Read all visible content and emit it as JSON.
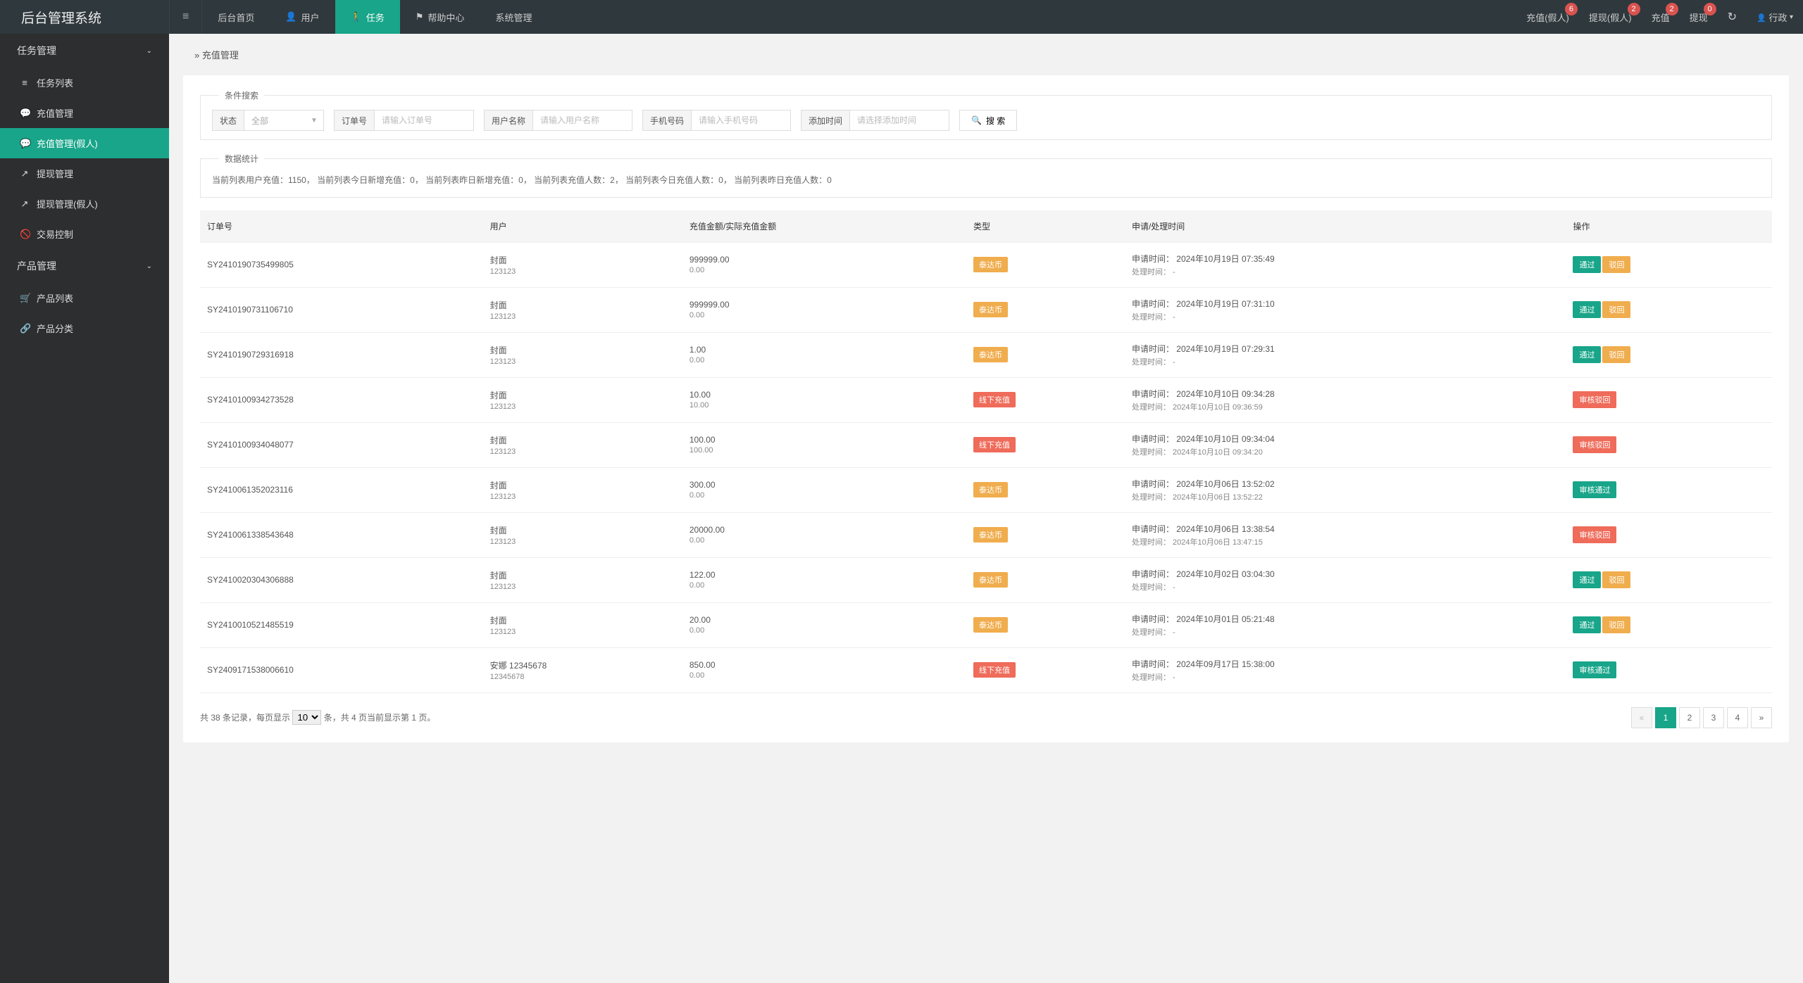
{
  "top": {
    "brand": "后台管理系统",
    "nav": [
      {
        "label": "后台首页"
      },
      {
        "label": "用户",
        "icon": "user"
      },
      {
        "label": "任务",
        "icon": "walk",
        "active": true
      },
      {
        "label": "帮助中心",
        "icon": "flag"
      },
      {
        "label": "系统管理"
      }
    ],
    "right": [
      {
        "label": "充值(假人)",
        "badge": "6"
      },
      {
        "label": "提现(假人)",
        "badge": "2"
      },
      {
        "label": "充值",
        "badge": "2"
      },
      {
        "label": "提现",
        "badge": "0"
      }
    ],
    "admin_label": "行政"
  },
  "sidebar": {
    "groups": [
      {
        "title": "任务管理",
        "items": [
          {
            "icon": "list",
            "label": "任务列表"
          },
          {
            "icon": "chat",
            "label": "充值管理"
          },
          {
            "icon": "chat",
            "label": "充值管理(假人)",
            "active": true
          },
          {
            "icon": "out",
            "label": "提现管理"
          },
          {
            "icon": "out",
            "label": "提现管理(假人)"
          },
          {
            "icon": "ban",
            "label": "交易控制"
          }
        ]
      },
      {
        "title": "产品管理",
        "items": [
          {
            "icon": "cart",
            "label": "产品列表"
          },
          {
            "icon": "link",
            "label": "产品分类"
          }
        ]
      }
    ]
  },
  "breadcrumb": "充值管理",
  "search": {
    "legend": "条件搜索",
    "status_label": "状态",
    "status_value": "全部",
    "orderno_label": "订单号",
    "orderno_ph": "请输入订单号",
    "username_label": "用户名称",
    "username_ph": "请输入用户名称",
    "phone_label": "手机号码",
    "phone_ph": "请输入手机号码",
    "time_label": "添加时间",
    "time_ph": "请选择添加时间",
    "btn": "搜 索"
  },
  "stats": {
    "legend": "数据统计",
    "text": "当前列表用户充值：1150，   当前列表今日新增充值：0，   当前列表昨日新增充值：0，   当前列表充值人数：2，   当前列表今日充值人数：0，   当前列表昨日充值人数：0"
  },
  "columns": [
    "订单号",
    "用户",
    "充值金额/实际充值金额",
    "类型",
    "申请/处理时间",
    "操作"
  ],
  "time_labels": {
    "apply": "申请时间：",
    "process": "处理时间："
  },
  "rows": [
    {
      "order": "SY2410190735499805",
      "user1": "封面",
      "user2": "123123",
      "amt1": "999999.00",
      "amt2": "0.00",
      "type": "泰达币",
      "typec": "tag-orange",
      "apply": "2024年10月19日 07:35:49",
      "process": "-",
      "ops": [
        {
          "t": "通过",
          "c": "btn-green"
        },
        {
          "t": "驳回",
          "c": "btn-yellow"
        }
      ]
    },
    {
      "order": "SY2410190731106710",
      "user1": "封面",
      "user2": "123123",
      "amt1": "999999.00",
      "amt2": "0.00",
      "type": "泰达币",
      "typec": "tag-orange",
      "apply": "2024年10月19日 07:31:10",
      "process": "-",
      "ops": [
        {
          "t": "通过",
          "c": "btn-green"
        },
        {
          "t": "驳回",
          "c": "btn-yellow"
        }
      ]
    },
    {
      "order": "SY2410190729316918",
      "user1": "封面",
      "user2": "123123",
      "amt1": "1.00",
      "amt2": "0.00",
      "type": "泰达币",
      "typec": "tag-orange",
      "apply": "2024年10月19日 07:29:31",
      "process": "-",
      "ops": [
        {
          "t": "通过",
          "c": "btn-green"
        },
        {
          "t": "驳回",
          "c": "btn-yellow"
        }
      ]
    },
    {
      "order": "SY2410100934273528",
      "user1": "封面",
      "user2": "123123",
      "amt1": "10.00",
      "amt2": "10.00",
      "type": "线下充值",
      "typec": "tag-red",
      "apply": "2024年10月10日 09:34:28",
      "process": "2024年10月10日 09:36:59",
      "ops": [
        {
          "t": "审核驳回",
          "c": "btn-danger"
        }
      ]
    },
    {
      "order": "SY2410100934048077",
      "user1": "封面",
      "user2": "123123",
      "amt1": "100.00",
      "amt2": "100.00",
      "type": "线下充值",
      "typec": "tag-red",
      "apply": "2024年10月10日 09:34:04",
      "process": "2024年10月10日 09:34:20",
      "ops": [
        {
          "t": "审核驳回",
          "c": "btn-danger"
        }
      ]
    },
    {
      "order": "SY2410061352023116",
      "user1": "封面",
      "user2": "123123",
      "amt1": "300.00",
      "amt2": "0.00",
      "type": "泰达币",
      "typec": "tag-orange",
      "apply": "2024年10月06日 13:52:02",
      "process": "2024年10月06日 13:52:22",
      "ops": [
        {
          "t": "审核通过",
          "c": "btn-green"
        }
      ]
    },
    {
      "order": "SY2410061338543648",
      "user1": "封面",
      "user2": "123123",
      "amt1": "20000.00",
      "amt2": "0.00",
      "type": "泰达币",
      "typec": "tag-orange",
      "apply": "2024年10月06日 13:38:54",
      "process": "2024年10月06日 13:47:15",
      "ops": [
        {
          "t": "审核驳回",
          "c": "btn-danger"
        }
      ]
    },
    {
      "order": "SY2410020304306888",
      "user1": "封面",
      "user2": "123123",
      "amt1": "122.00",
      "amt2": "0.00",
      "type": "泰达币",
      "typec": "tag-orange",
      "apply": "2024年10月02日 03:04:30",
      "process": "-",
      "ops": [
        {
          "t": "通过",
          "c": "btn-green"
        },
        {
          "t": "驳回",
          "c": "btn-yellow"
        }
      ]
    },
    {
      "order": "SY2410010521485519",
      "user1": "封面",
      "user2": "123123",
      "amt1": "20.00",
      "amt2": "0.00",
      "type": "泰达币",
      "typec": "tag-orange",
      "apply": "2024年10月01日 05:21:48",
      "process": "-",
      "ops": [
        {
          "t": "通过",
          "c": "btn-green"
        },
        {
          "t": "驳回",
          "c": "btn-yellow"
        }
      ]
    },
    {
      "order": "SY2409171538006610",
      "user1": "安娜 12345678",
      "user2": "12345678",
      "amt1": "850.00",
      "amt2": "0.00",
      "type": "线下充值",
      "typec": "tag-red",
      "apply": "2024年09月17日 15:38:00",
      "process": "-",
      "ops": [
        {
          "t": "审核通过",
          "c": "btn-green"
        }
      ]
    }
  ],
  "pager": {
    "total_prefix": "共 ",
    "total": "38",
    "total_mid": " 条记录，每页显示 ",
    "perpage": "10",
    "total_suffix": " 条，共 4 页当前显示第 1 页。",
    "pages": [
      "«",
      "1",
      "2",
      "3",
      "4",
      "»"
    ],
    "active": "1"
  }
}
